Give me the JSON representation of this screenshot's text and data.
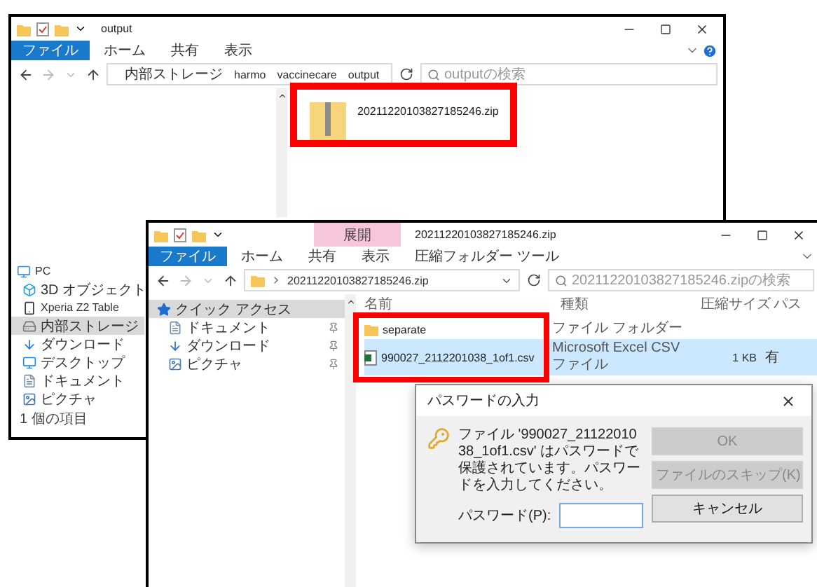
{
  "explorer_main": {
    "title": "output",
    "ribbon_tabs": [
      {
        "label": "ファイル",
        "selected": true
      },
      {
        "label": "ホーム",
        "selected": false
      },
      {
        "label": "共有",
        "selected": false
      },
      {
        "label": "表示",
        "selected": false
      }
    ],
    "path": [
      "内部ストレージ",
      "harmo",
      "vaccinecare",
      "output"
    ],
    "search": {
      "placeholder": "outputの検索"
    },
    "nav_items": [
      {
        "label": "PC",
        "selected": false
      },
      {
        "label": "3D オブジェクト",
        "selected": false
      },
      {
        "label": "Xperia Z2 Table",
        "selected": false
      },
      {
        "label": "内部ストレージ",
        "selected": true
      },
      {
        "label": "ダウンロード",
        "selected": false
      },
      {
        "label": "デスクトップ",
        "selected": false
      },
      {
        "label": "ドキュメント",
        "selected": false
      },
      {
        "label": "ピクチャ",
        "selected": false
      }
    ],
    "files": [
      {
        "name": "20211220103827185246.zip"
      }
    ],
    "status": "1 個の項目"
  },
  "explorer_zip": {
    "context_header": "展開",
    "title": "20211220103827185246.zip",
    "ribbon_tabs": [
      {
        "label": "ファイル",
        "selected": true
      },
      {
        "label": "ホーム",
        "selected": false
      },
      {
        "label": "共有",
        "selected": false
      },
      {
        "label": "表示",
        "selected": false
      },
      {
        "label": "圧縮フォルダー ツール",
        "selected": false
      }
    ],
    "path": [
      "20211220103827185246.zip"
    ],
    "search": {
      "placeholder": "20211220103827185246.zipの検索"
    },
    "nav_items": [
      {
        "label": "クイック アクセス",
        "selected": true,
        "pinned": false
      },
      {
        "label": "ドキュメント",
        "selected": false,
        "pinned": true
      },
      {
        "label": "ダウンロード",
        "selected": false,
        "pinned": true
      },
      {
        "label": "ピクチャ",
        "selected": false,
        "pinned": true
      }
    ],
    "columns": [
      "名前",
      "種類",
      "圧縮サイズ",
      "パス"
    ],
    "rows": [
      {
        "kind": "folder",
        "name": "separate",
        "type": "ファイル フォルダー",
        "selected": false
      },
      {
        "kind": "csv",
        "name": "990027_2112201038_1of1.csv",
        "type": "Microsoft Excel CSV ファイル",
        "size": "1 KB",
        "path": "有",
        "selected": true
      }
    ]
  },
  "password_dialog": {
    "title": "パスワードの入力",
    "message": "ファイル '990027_2112201038_1of1.csv' はパスワードで保護されています。パスワードを入力してください。",
    "field_label": "パスワード(P):",
    "buttons": [
      {
        "label": "OK",
        "disabled": true
      },
      {
        "label": "ファイルのスキップ(K)",
        "disabled": true
      },
      {
        "label": "キャンセル",
        "disabled": false
      }
    ]
  }
}
